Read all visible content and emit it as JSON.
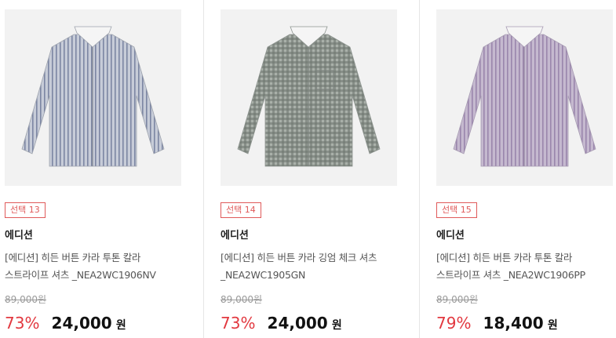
{
  "products": [
    {
      "badge": "선택 13",
      "brand": "에디션",
      "name": "[에디션] 히든 버튼 카라 투톤 칼라 스트라이프 셔츠 _NEA2WC1906NV",
      "original_price": "89,000원",
      "discount": "73%",
      "price": "24,000",
      "currency": "원",
      "image": "striped-shirt-navy",
      "shirt_color": "#c7ccd8",
      "pattern_color": "#7c86a3",
      "pattern": "stripe"
    },
    {
      "badge": "선택 14",
      "brand": "에디션",
      "name": "[에디션] 히든 버튼 카라 깅엄 체크 셔츠 _NEA2WC1905GN",
      "original_price": "89,000원",
      "discount": "73%",
      "price": "24,000",
      "currency": "원",
      "image": "gingham-check-shirt-green",
      "shirt_color": "#a9b0a9",
      "pattern_color": "#6f7872",
      "pattern": "check"
    },
    {
      "badge": "선택 15",
      "brand": "에디션",
      "name": "[에디션] 히든 버튼 카라 투톤 칼라 스트라이프 셔츠 _NEA2WC1906PP",
      "original_price": "89,000원",
      "discount": "79%",
      "price": "18,400",
      "currency": "원",
      "image": "striped-shirt-purple",
      "shirt_color": "#c5b9cf",
      "pattern_color": "#9a86ac",
      "pattern": "stripe"
    }
  ],
  "colors": {
    "accent": "#e2383f",
    "badge": "#e05a5a",
    "divider": "#e6e6e6"
  }
}
